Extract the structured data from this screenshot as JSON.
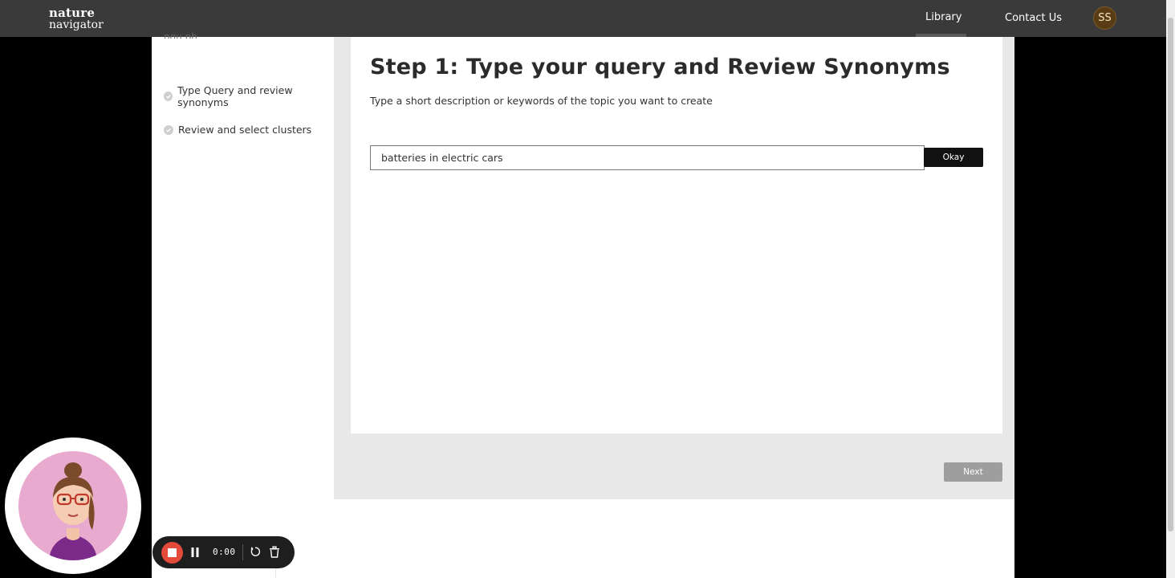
{
  "header": {
    "logo_line1": "nature",
    "logo_line2": "navigator",
    "nav_library": "Library",
    "nav_contact": "Contact Us",
    "avatar_initials": "SS"
  },
  "sidebar": {
    "clipped_heading": "ngu                              ph",
    "items": [
      {
        "label": "Type Query and review synonyms",
        "icon": "check-circle-icon"
      },
      {
        "label": "Review and select clusters",
        "icon": "check-circle-icon"
      }
    ]
  },
  "main": {
    "step_title": "Step 1: Type your query and Review Synonyms",
    "step_description": "Type a short description or keywords of the topic you want to create",
    "query_value": "batteries in electric cars",
    "okay_label": "Okay",
    "next_label": "Next"
  },
  "recorder": {
    "time": "0:00",
    "stop_color": "#e34a3a"
  },
  "colors": {
    "topbar": "#3a3a3a",
    "main_bg": "#e8e8e8",
    "assistant_bg": "#e9aad0",
    "avatar_bg": "#5a3c14"
  }
}
